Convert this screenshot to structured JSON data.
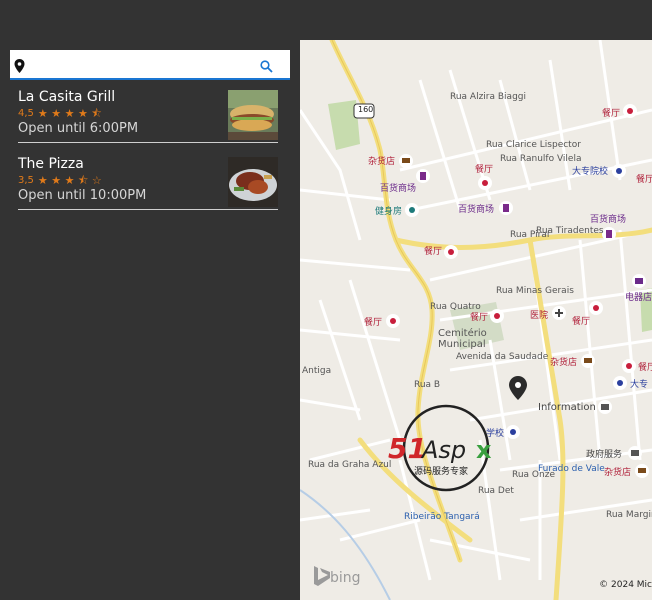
{
  "search": {
    "value": "",
    "placeholder": ""
  },
  "results": [
    {
      "name": "La Casita Grill",
      "rating": "4,5",
      "stars": "★ ★ ★ ★ ⯪",
      "hours": "Open until 6:00PM"
    },
    {
      "name": "The Pizza",
      "rating": "3,5",
      "stars": "★ ★ ★ ⯪ ☆",
      "hours": "Open until 10:00PM"
    }
  ],
  "map": {
    "labels": {
      "rua_alzira_biaggi": "Rua Alzira Biaggi",
      "rua_clarice": "Rua Clarice Lispector",
      "rua_ranulfo": "Rua Ranulfo Vilela",
      "route_160": "160",
      "rua_tiradentes": "Rua Tiradentes",
      "rua_minas": "Rua Minas Gerais",
      "rua_quatro": "Rua Quatro",
      "cemiterio": "Cemitério Municipal",
      "avenida_saudade": "Avenida da Saudade",
      "rua_b": "Rua B",
      "rua_det": "Rua Det",
      "rua_onze": "Rua Onze",
      "furado": "Furado de Vale",
      "ribeirao": "Ribeirão Tangará",
      "rua_graha": "Rua da Graha Azul",
      "antiga": "Antiga",
      "rua_pirai": "Rua Piraí",
      "rua_marg": "Rua Margina",
      "information": "Information"
    },
    "pois": {
      "canting1": "餐厅",
      "canting2": "餐厅",
      "canting3": "餐厅",
      "canting4": "餐厅",
      "canting5": "餐厅",
      "canting6": "餐厅",
      "canting7": "餐厅",
      "canting8": "餐厅",
      "zahuo1": "杂货店",
      "zahuo2": "杂货店",
      "zahuo3": "杂货店",
      "baihuo1": "百货商场",
      "baihuo2": "百货商场",
      "baihuo3": "百货商场",
      "jianshen": "健身房",
      "dazhuan1": "大专院校",
      "dazhuan2": "大专",
      "yiyuan": "医院",
      "dianqi": "电器店",
      "zhengfu": "政府服务",
      "xuexiao": "学校"
    },
    "watermark": {
      "brand": "51Aspx",
      "tagline": "源码服务专家"
    },
    "bing": "bing",
    "copyright": "© 2024 Mic"
  }
}
